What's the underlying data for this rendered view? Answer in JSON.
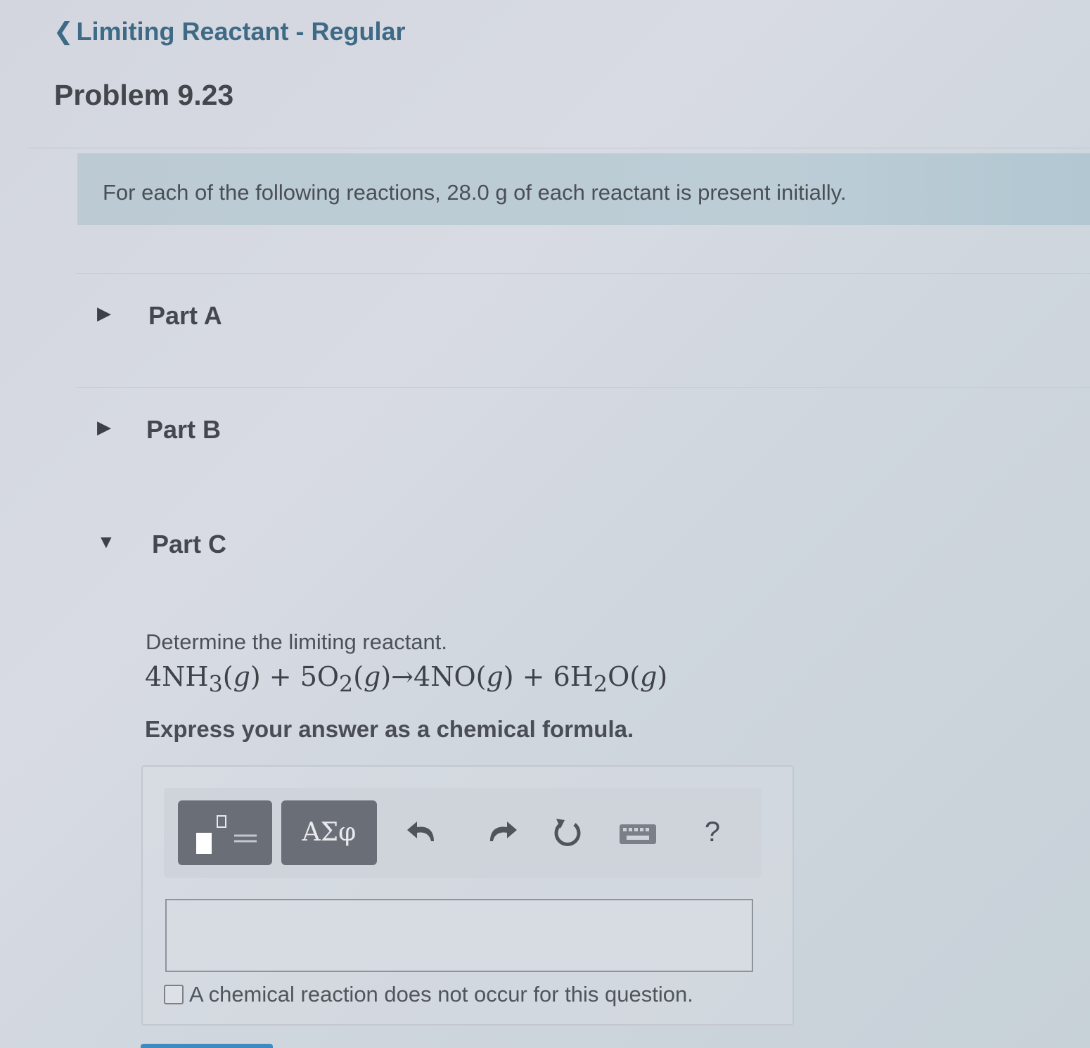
{
  "header": {
    "back_link": "Limiting Reactant - Regular",
    "problem_title": "Problem 9.23"
  },
  "intro": {
    "text": "For each of the following reactions, 28.0 g of each reactant is present initially."
  },
  "parts": [
    {
      "label": "Part A",
      "state": "collapsed"
    },
    {
      "label": "Part B",
      "state": "collapsed"
    },
    {
      "label": "Part C",
      "state": "expanded"
    }
  ],
  "part_c": {
    "question": "Determine the limiting reactant.",
    "equation": {
      "t1": "4NH",
      "s1": "3",
      "t2": "(",
      "g1": "g",
      "t3": ") + 5O",
      "s2": "2",
      "t4": "(",
      "g2": "g",
      "t5": ")→4NO(",
      "g3": "g",
      "t6": ") + 6H",
      "s3": "2",
      "t7": "O(",
      "g4": "g",
      "t8": ")"
    },
    "instruction": "Express your answer as a chemical formula."
  },
  "toolbar": {
    "greek_label": "ΑΣφ",
    "help_label": "?",
    "icons": [
      "templates-icon",
      "greek-letters-icon",
      "undo-icon",
      "redo-icon",
      "reset-icon",
      "keyboard-icon",
      "help-icon"
    ]
  },
  "answer": {
    "value": "",
    "no_reaction_label": "A chemical reaction does not occur for this question.",
    "no_reaction_checked": false
  },
  "colors": {
    "link": "#3e6a86",
    "intro_bg": "#bccbd3",
    "toolbar_button": "#6a6e76",
    "submit_button": "#3b8dbf"
  }
}
